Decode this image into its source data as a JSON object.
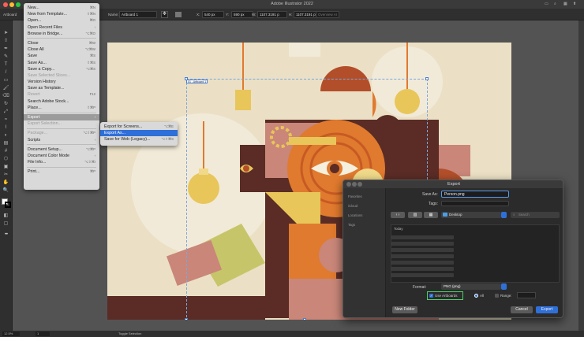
{
  "app": {
    "title": "Adobe Illustrator 2022"
  },
  "control_bar": {
    "mode_label": "Artboard",
    "name_label": "Name:",
    "name_value": "Artboard 1",
    "x_label": "X:",
    "x_value": "540 px",
    "y_label": "Y:",
    "y_value": "590 px",
    "w_label": "W:",
    "w_value": "1107.3191 p",
    "h_label": "H:",
    "h_value": "1107.3191 p",
    "trailing_label": "Overview AI"
  },
  "artboard_tag": "01 - Artboard 1",
  "file_menu": {
    "items": [
      {
        "label": "New...",
        "shortcut": "⌘N"
      },
      {
        "label": "New from Template...",
        "shortcut": "⇧⌘N"
      },
      {
        "label": "Open...",
        "shortcut": "⌘O"
      },
      {
        "label": "Open Recent Files",
        "shortcut": "›"
      },
      {
        "label": "Browse in Bridge...",
        "shortcut": "⌥⌘O"
      },
      {
        "sep": true
      },
      {
        "label": "Close",
        "shortcut": "⌘W"
      },
      {
        "label": "Close All",
        "shortcut": "⌥⌘W"
      },
      {
        "label": "Save",
        "shortcut": "⌘S"
      },
      {
        "label": "Save As...",
        "shortcut": "⇧⌘S"
      },
      {
        "label": "Save a Copy...",
        "shortcut": "⌥⌘S"
      },
      {
        "label": "Save Selected Slices...",
        "shortcut": "",
        "disabled": true
      },
      {
        "label": "Version History",
        "shortcut": ""
      },
      {
        "label": "Save as Template...",
        "shortcut": ""
      },
      {
        "label": "Revert",
        "shortcut": "F12",
        "disabled": true
      },
      {
        "label": "Search Adobe Stock...",
        "shortcut": ""
      },
      {
        "label": "Place...",
        "shortcut": "⇧⌘P"
      },
      {
        "sep": true
      },
      {
        "label": "Export",
        "shortcut": "›",
        "selected": true
      },
      {
        "label": "Export Selection...",
        "shortcut": "",
        "disabled": true
      },
      {
        "sep": true
      },
      {
        "label": "Package...",
        "shortcut": "⌥⇧⌘P",
        "disabled": true
      },
      {
        "label": "Scripts",
        "shortcut": "›"
      },
      {
        "sep": true
      },
      {
        "label": "Document Setup...",
        "shortcut": "⌥⌘P"
      },
      {
        "label": "Document Color Mode",
        "shortcut": "›"
      },
      {
        "label": "File Info...",
        "shortcut": "⌥⇧⌘I"
      },
      {
        "sep": true
      },
      {
        "label": "Print...",
        "shortcut": "⌘P"
      }
    ]
  },
  "export_submenu": {
    "items": [
      {
        "label": "Export for Screens...",
        "shortcut": "⌥⌘E"
      },
      {
        "label": "Export As...",
        "shortcut": "",
        "selected": true
      },
      {
        "label": "Save for Web (Legacy)...",
        "shortcut": "⌥⇧⌘S"
      }
    ]
  },
  "export_dialog": {
    "title": "Export",
    "save_as_label": "Save As:",
    "save_as_value": "Person.png",
    "tags_label": "Tags:",
    "location": "Desktop",
    "search_placeholder": "Search",
    "column_header": "Today",
    "sidebar": [
      "Favorites",
      "iCloud",
      "Locations",
      "Tags"
    ],
    "format_label": "Format:",
    "format_value": "PNG (png)",
    "use_artboards_label": "Use Artboards",
    "all_label": "All",
    "range_label": "Range:",
    "new_folder_label": "New Folder",
    "cancel_label": "Cancel",
    "export_label": "Export"
  },
  "status_bar": {
    "zoom": "12.5%",
    "artboard_num": "1",
    "tool_text": "Toggle Selection"
  },
  "colors": {
    "art_bg": "#ebe0c5",
    "brown_dark": "#5a2c25",
    "orange": "#e07a2e",
    "mustard": "#e8c65a",
    "pink": "#c98679",
    "rust": "#b24f2a",
    "olive": "#c7c56a",
    "accent_blue": "#2f6fd8",
    "selection_green": "#4cd26a"
  }
}
